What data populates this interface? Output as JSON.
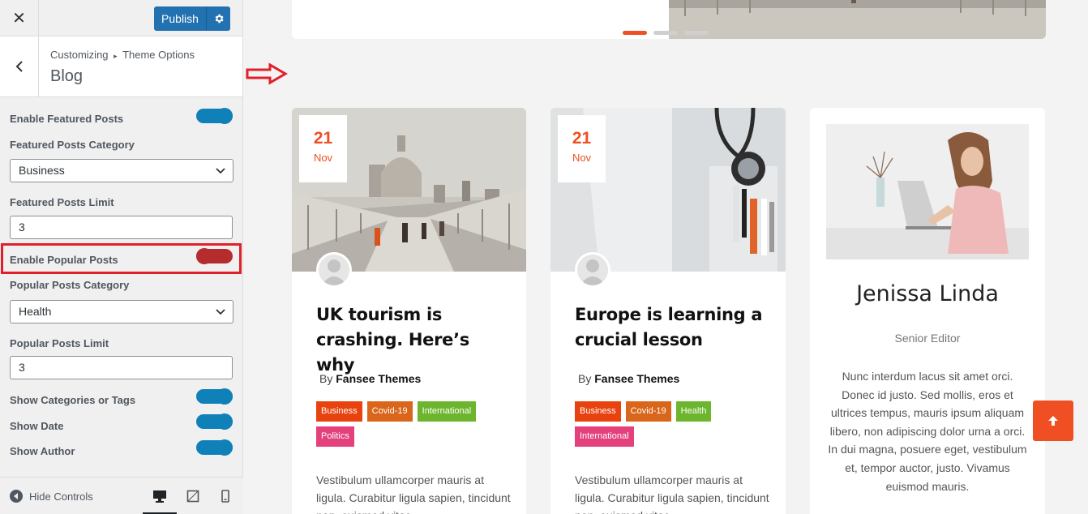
{
  "sidebar": {
    "close_label": "✕",
    "publish_label": "Publish",
    "breadcrumb": {
      "root": "Customizing",
      "sep": "▸",
      "section": "Theme Options"
    },
    "title": "Blog",
    "controls": {
      "enable_featured": {
        "label": "Enable Featured Posts",
        "on": true
      },
      "featured_category": {
        "label": "Featured Posts Category",
        "value": "Business"
      },
      "featured_limit": {
        "label": "Featured Posts Limit",
        "value": "3"
      },
      "enable_popular": {
        "label": "Enable Popular Posts",
        "on": false
      },
      "popular_category": {
        "label": "Popular Posts Category",
        "value": "Health"
      },
      "popular_limit": {
        "label": "Popular Posts Limit",
        "value": "3"
      },
      "show_cats": {
        "label": "Show Categories or Tags",
        "on": true
      },
      "show_date": {
        "label": "Show Date",
        "on": true
      },
      "show_author": {
        "label": "Show Author",
        "on": true
      }
    },
    "footer": {
      "hide_controls": "Hide Controls"
    }
  },
  "preview": {
    "posts": [
      {
        "day": "21",
        "month": "Nov",
        "title": "UK tourism is crashing. Here’s why",
        "by": "By",
        "author": "Fansee Themes",
        "tags": [
          {
            "label": "Business",
            "color": "#e8420f"
          },
          {
            "label": "Covid-19",
            "color": "#d9661a"
          },
          {
            "label": "International",
            "color": "#6cb52d"
          },
          {
            "label": "Politics",
            "color": "#e3407c"
          }
        ],
        "excerpt": "Vestibulum ullamcorper mauris at ligula. Curabitur ligula sapien, tincidunt non, euismod vitae"
      },
      {
        "day": "21",
        "month": "Nov",
        "title": "Europe is learning a crucial lesson",
        "by": "By",
        "author": "Fansee Themes",
        "tags": [
          {
            "label": "Business",
            "color": "#e8420f"
          },
          {
            "label": "Covid-19",
            "color": "#d9661a"
          },
          {
            "label": "Health",
            "color": "#6cb52d"
          },
          {
            "label": "International",
            "color": "#e3407c"
          }
        ],
        "excerpt": "Vestibulum ullamcorper mauris at ligula. Curabitur ligula sapien, tincidunt non, euismod vitae"
      }
    ],
    "profile": {
      "name": "Jenissa Linda",
      "role": "Senior Editor",
      "bio": "Nunc interdum lacus sit amet orci. Donec id justo. Sed mollis, eros et ultrices tempus, mauris ipsum aliquam libero, non adipiscing dolor urna a orci. In dui magna, posuere eget, vestibulum et, tempor auctor, justo. Vivamus euismod mauris."
    }
  },
  "colors": {
    "accent": "#f04e23",
    "wp_blue": "#2271b1",
    "toggle_on": "#0f80b8",
    "toggle_off": "#b52c2c",
    "highlight": "#e0202a"
  }
}
